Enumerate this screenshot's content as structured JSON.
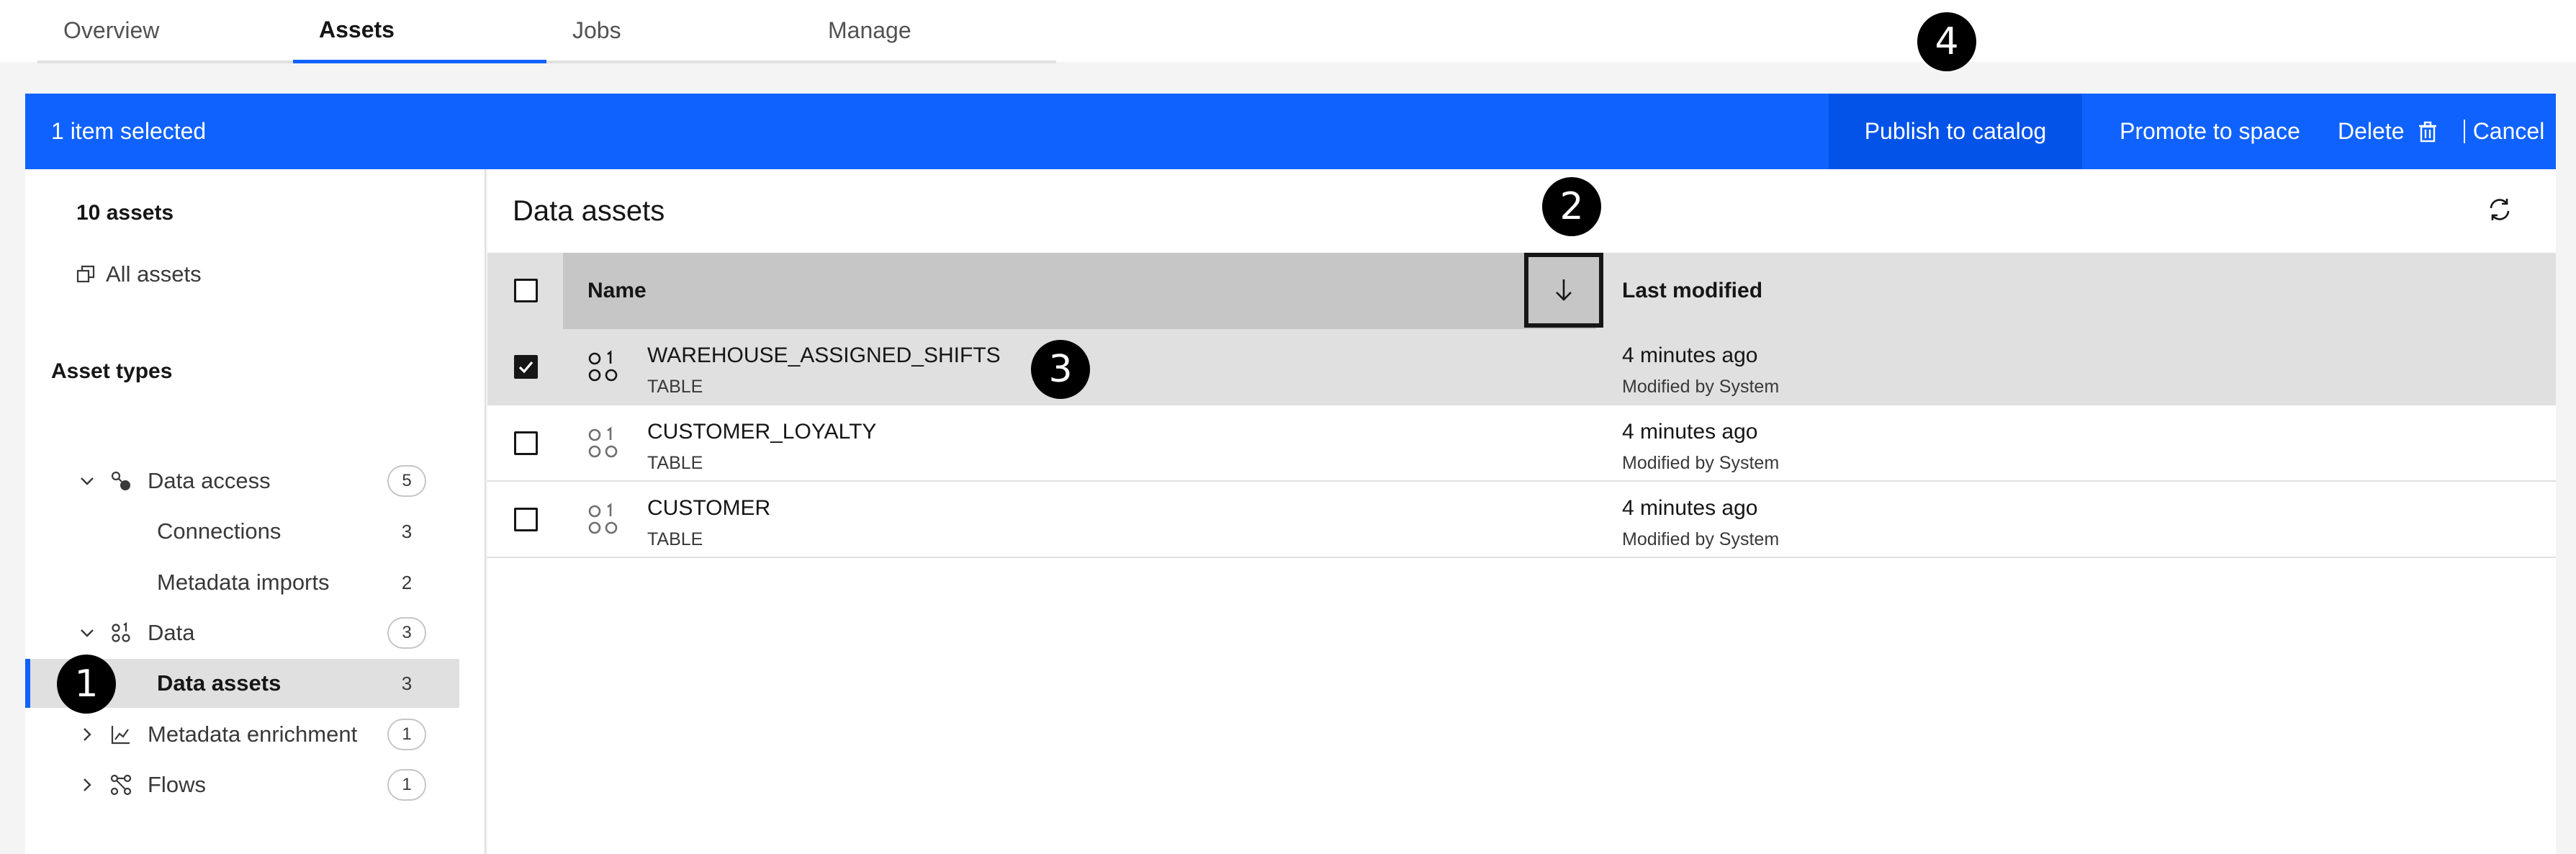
{
  "tabs": [
    {
      "label": "Overview",
      "active": false
    },
    {
      "label": "Assets",
      "active": true
    },
    {
      "label": "Jobs",
      "active": false
    },
    {
      "label": "Manage",
      "active": false
    }
  ],
  "selection_bar": {
    "count_text": "1 item selected",
    "publish_label": "Publish to catalog",
    "promote_label": "Promote to space",
    "delete_label": "Delete",
    "cancel_label": "Cancel"
  },
  "sidebar": {
    "asset_count": "10 assets",
    "all_assets_label": "All assets",
    "asset_types_heading": "Asset types",
    "tree": [
      {
        "label": "Data access",
        "count": "5",
        "icon": "data-access-icon",
        "expanded": true
      },
      {
        "label": "Connections",
        "count": "3"
      },
      {
        "label": "Metadata imports",
        "count": "2"
      },
      {
        "label": "Data",
        "count": "3",
        "icon": "data-icon",
        "expanded": true
      },
      {
        "label": "Data assets",
        "count": "3",
        "selected": true
      },
      {
        "label": "Metadata enrichment",
        "count": "1",
        "icon": "metadata-enrichment-icon",
        "expanded": false
      },
      {
        "label": "Flows",
        "count": "1",
        "icon": "flows-icon",
        "expanded": false
      }
    ]
  },
  "main": {
    "title": "Data assets",
    "columns": {
      "name": "Name",
      "modified": "Last modified"
    },
    "rows": [
      {
        "name": "WAREHOUSE_ASSIGNED_SHIFTS",
        "type": "TABLE",
        "time": "4 minutes ago",
        "by": "Modified by System",
        "checked": true
      },
      {
        "name": "CUSTOMER_LOYALTY",
        "type": "TABLE",
        "time": "4 minutes ago",
        "by": "Modified by System",
        "checked": false
      },
      {
        "name": "CUSTOMER",
        "type": "TABLE",
        "time": "4 minutes ago",
        "by": "Modified by System",
        "checked": false
      }
    ]
  },
  "markers": [
    "1",
    "2",
    "3",
    "4"
  ],
  "colors": {
    "accent": "#0f62fe",
    "header_bg": "#e0e0e0",
    "selected_row": "#e0e0e0"
  }
}
